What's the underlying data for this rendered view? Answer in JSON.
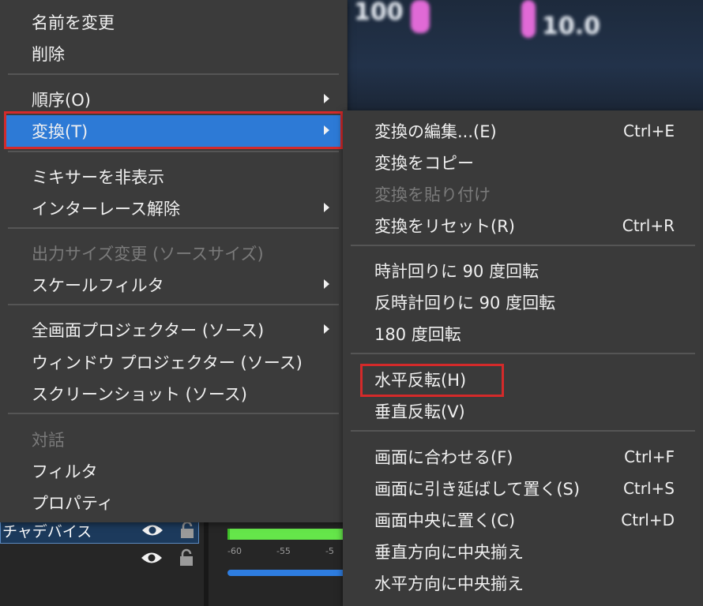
{
  "colors": {
    "menu_bg": "#3b3b3b",
    "highlight": "#2d7ad6",
    "annotation": "#d42a2a",
    "disabled": "#7a7a7a"
  },
  "preview": {
    "numbers": [
      "100",
      "10.0"
    ]
  },
  "sources": [
    {
      "name": "チャデバイス",
      "selected": true,
      "visibility_icon": "eye-icon",
      "lock_icon": "lock-icon"
    },
    {
      "name": "",
      "selected": false,
      "visibility_icon": "eye-icon",
      "lock_icon": "lock-icon"
    }
  ],
  "mixer": {
    "ticks": [
      "-60",
      "-55",
      "-5"
    ]
  },
  "context_menu": {
    "items": [
      {
        "label": "名前を変更",
        "enabled": true
      },
      {
        "label": "削除",
        "enabled": true
      },
      {
        "label": "順序(O)",
        "enabled": true,
        "submenu": true
      },
      {
        "label": "変換(T)",
        "enabled": true,
        "submenu": true,
        "highlighted": true
      },
      {
        "label": "ミキサーを非表示",
        "enabled": true
      },
      {
        "label": "インターレース解除",
        "enabled": true,
        "submenu": true
      },
      {
        "label": "出力サイズ変更 (ソースサイズ)",
        "enabled": false
      },
      {
        "label": "スケールフィルタ",
        "enabled": true,
        "submenu": true
      },
      {
        "label": "全画面プロジェクター (ソース)",
        "enabled": true,
        "submenu": true
      },
      {
        "label": "ウィンドウ プロジェクター (ソース)",
        "enabled": true
      },
      {
        "label": "スクリーンショット (ソース)",
        "enabled": true
      },
      {
        "label": "対話",
        "enabled": false
      },
      {
        "label": "フィルタ",
        "enabled": true
      },
      {
        "label": "プロパティ",
        "enabled": true
      }
    ]
  },
  "transform_submenu": {
    "items": [
      {
        "label": "変換の編集...(E)",
        "shortcut": "Ctrl+E",
        "enabled": true
      },
      {
        "label": "変換をコピー",
        "shortcut": "",
        "enabled": true
      },
      {
        "label": "変換を貼り付け",
        "shortcut": "",
        "enabled": false
      },
      {
        "label": "変換をリセット(R)",
        "shortcut": "Ctrl+R",
        "enabled": true
      },
      {
        "label": "時計回りに 90 度回転",
        "shortcut": "",
        "enabled": true
      },
      {
        "label": "反時計回りに 90 度回転",
        "shortcut": "",
        "enabled": true
      },
      {
        "label": "180 度回転",
        "shortcut": "",
        "enabled": true
      },
      {
        "label": "水平反転(H)",
        "shortcut": "",
        "enabled": true,
        "annotated": true
      },
      {
        "label": "垂直反転(V)",
        "shortcut": "",
        "enabled": true
      },
      {
        "label": "画面に合わせる(F)",
        "shortcut": "Ctrl+F",
        "enabled": true
      },
      {
        "label": "画面に引き延ばして置く(S)",
        "shortcut": "Ctrl+S",
        "enabled": true
      },
      {
        "label": "画面中央に置く(C)",
        "shortcut": "Ctrl+D",
        "enabled": true
      },
      {
        "label": "垂直方向に中央揃え",
        "shortcut": "",
        "enabled": true
      },
      {
        "label": "水平方向に中央揃え",
        "shortcut": "",
        "enabled": true
      }
    ]
  }
}
